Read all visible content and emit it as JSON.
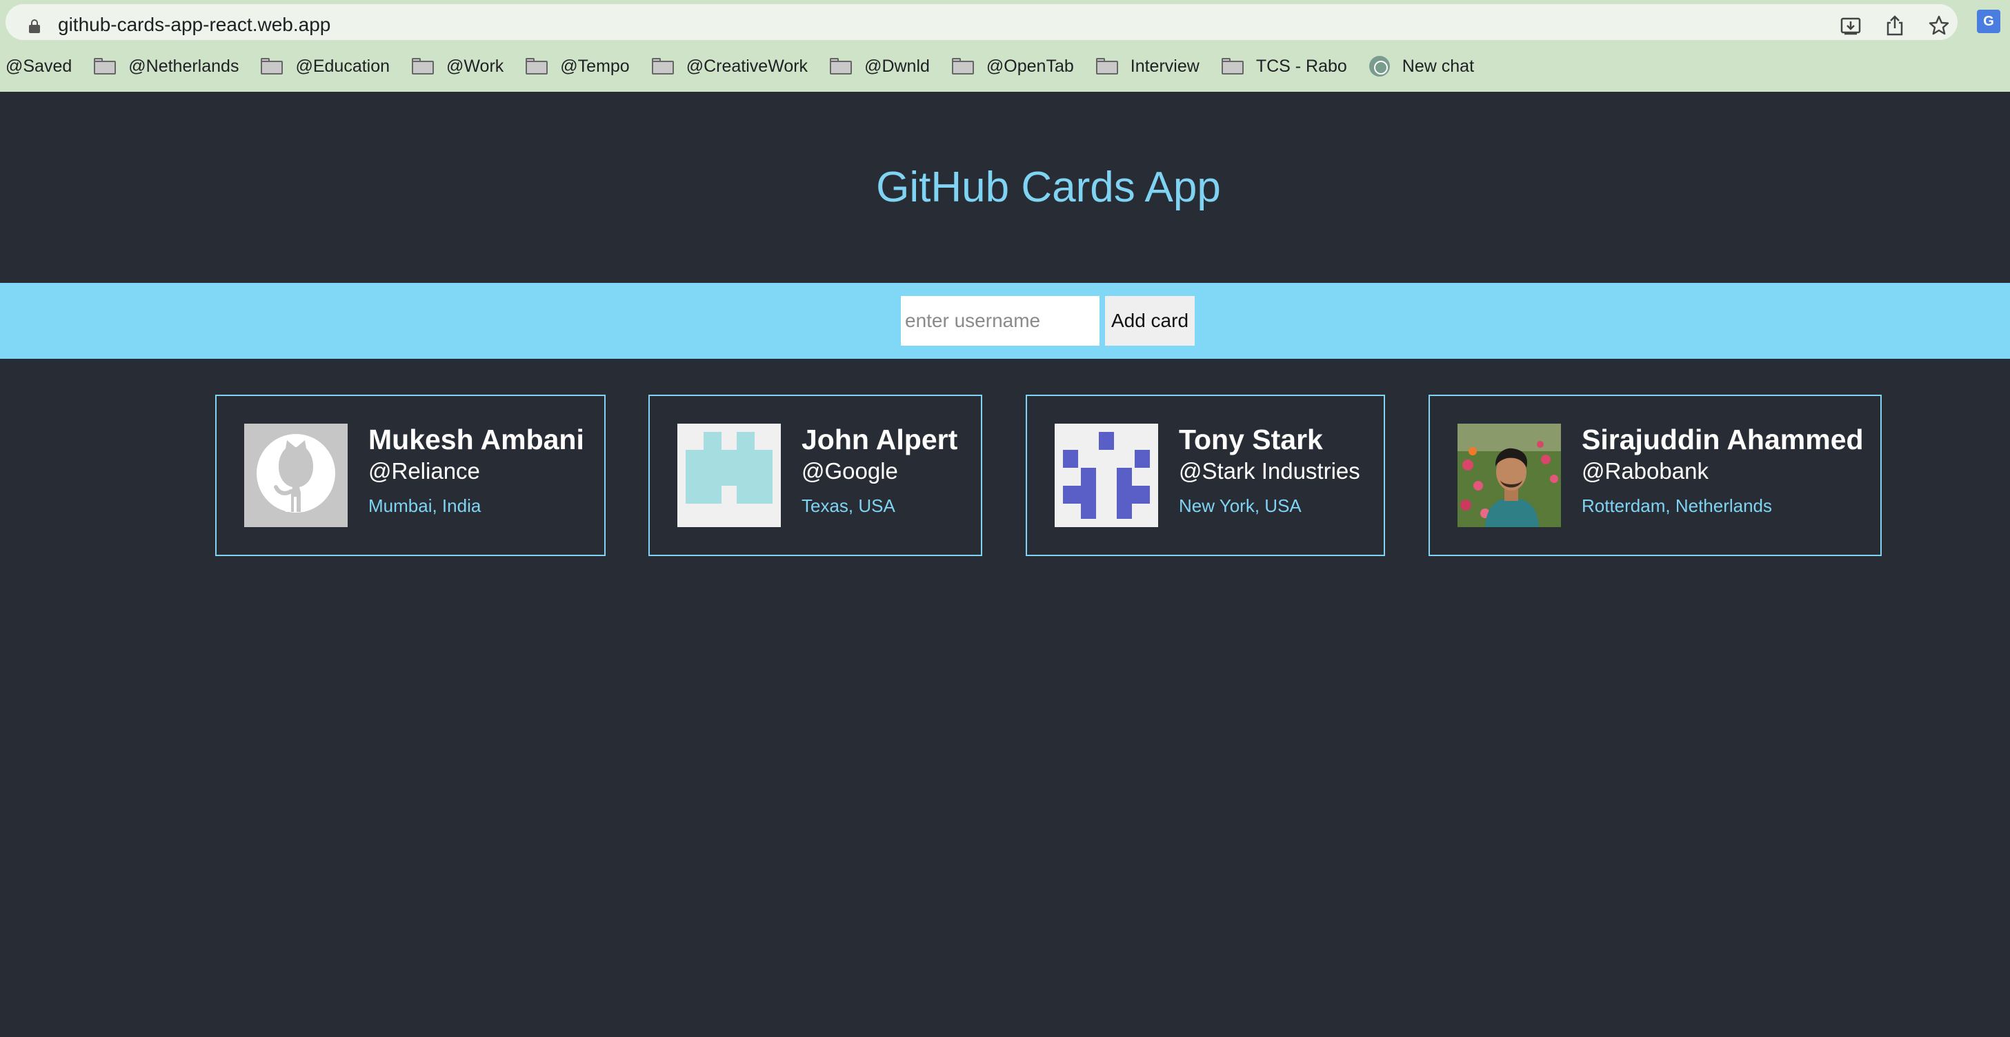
{
  "browser": {
    "url": "github-cards-app-react.web.app",
    "bookmarks": [
      {
        "label": "@Saved",
        "icon": "none"
      },
      {
        "label": "@Netherlands",
        "icon": "folder-icon"
      },
      {
        "label": "@Education",
        "icon": "folder-icon"
      },
      {
        "label": "@Work",
        "icon": "folder-icon"
      },
      {
        "label": "@Tempo",
        "icon": "folder-icon"
      },
      {
        "label": "@CreativeWork",
        "icon": "folder-icon"
      },
      {
        "label": "@Dwnld",
        "icon": "folder-icon"
      },
      {
        "label": "@OpenTab",
        "icon": "folder-icon"
      },
      {
        "label": "Interview",
        "icon": "folder-icon"
      },
      {
        "label": "TCS - Rabo",
        "icon": "folder-icon"
      },
      {
        "label": "New chat",
        "icon": "chat-icon"
      }
    ]
  },
  "app": {
    "title": "GitHub Cards App",
    "form": {
      "input_placeholder": "enter username",
      "input_value": "",
      "button_label": "Add card"
    },
    "cards": [
      {
        "name": "Mukesh Ambani",
        "company": "@Reliance",
        "location": "Mumbai, India",
        "avatar": "github-octocat-avatar"
      },
      {
        "name": "John Alpert",
        "company": "@Google",
        "location": "Texas, USA",
        "avatar": "identicon-teal-avatar"
      },
      {
        "name": "Tony Stark",
        "company": "@Stark Industries",
        "location": "New York, USA",
        "avatar": "identicon-purple-avatar"
      },
      {
        "name": "Sirajuddin Ahammed",
        "company": "@Rabobank",
        "location": "Rotterdam, Netherlands",
        "avatar": "user-photo-avatar"
      }
    ]
  },
  "colors": {
    "page_bg": "#282c34",
    "accent": "#7fd3f3",
    "form_band": "#80d8f6",
    "chrome_bg": "#cfe3c9"
  }
}
